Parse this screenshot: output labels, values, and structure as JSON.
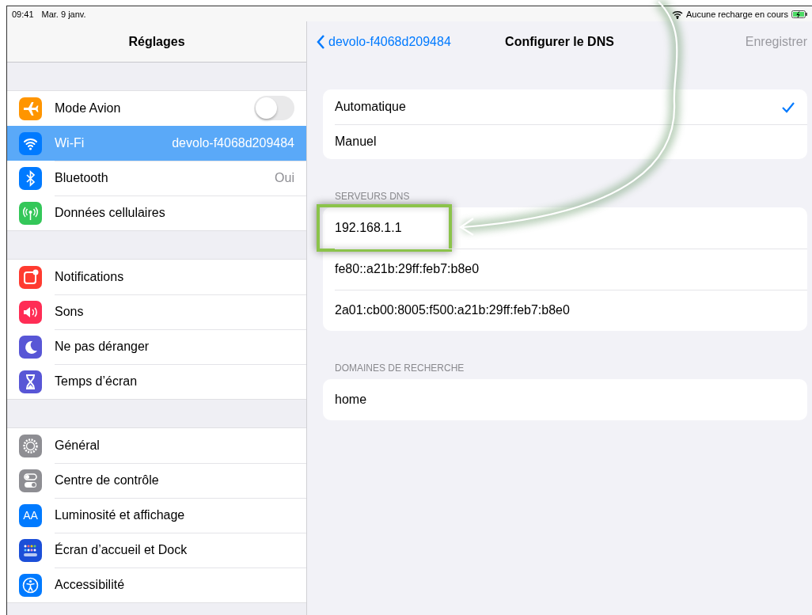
{
  "status_bar": {
    "time": "09:41",
    "date": "Mar. 9 janv.",
    "charging_text": "Aucune recharge en cours"
  },
  "sidebar": {
    "title": "Réglages",
    "sections": [
      [
        {
          "label": "Mode Avion",
          "kind": "toggle",
          "on": false,
          "selected": false,
          "color": "#ff9500"
        },
        {
          "label": "Wi-Fi",
          "value": "devolo-f4068d209484",
          "kind": "link",
          "selected": true,
          "color": "#007aff"
        },
        {
          "label": "Bluetooth",
          "value": "Oui",
          "kind": "link",
          "selected": false,
          "color": "#007aff"
        },
        {
          "label": "Données cellulaires",
          "kind": "link",
          "selected": false,
          "color": "#34c759"
        }
      ],
      [
        {
          "label": "Notifications",
          "kind": "link",
          "selected": false,
          "color": "#ff3b30"
        },
        {
          "label": "Sons",
          "kind": "link",
          "selected": false,
          "color": "#ff2d55"
        },
        {
          "label": "Ne pas déranger",
          "kind": "link",
          "selected": false,
          "color": "#5856d6"
        },
        {
          "label": "Temps d’écran",
          "kind": "link",
          "selected": false,
          "color": "#5856d6"
        }
      ],
      [
        {
          "label": "Général",
          "kind": "link",
          "selected": false,
          "color": "#8e8e93"
        },
        {
          "label": "Centre de contrôle",
          "kind": "link",
          "selected": false,
          "color": "#8e8e93"
        },
        {
          "label": "Luminosité et affichage",
          "kind": "link",
          "selected": false,
          "color": "#007aff",
          "icon_text": "AA"
        },
        {
          "label": "Écran d’accueil et Dock",
          "kind": "link",
          "selected": false,
          "color": "#1c4fd8"
        },
        {
          "label": "Accessibilité",
          "kind": "link",
          "selected": false,
          "color": "#007aff"
        }
      ]
    ]
  },
  "detail": {
    "back": "devolo-f4068d209484",
    "title": "Configurer le DNS",
    "save": {
      "label": "Enregistrer",
      "disabled": true
    },
    "modes": [
      {
        "label": "Automatique",
        "selected": true
      },
      {
        "label": "Manuel",
        "selected": false
      }
    ],
    "dns_header": "SERVEURS DNS",
    "dns_servers": [
      {
        "address": "192.168.1.1",
        "highlighted": true
      },
      {
        "address": "fe80::a21b:29ff:feb7:b8e0",
        "highlighted": false
      },
      {
        "address": "2a01:cb00:8005:f500:a21b:29ff:feb7:b8e0",
        "highlighted": false
      }
    ],
    "search_header": "DOMAINES DE RECHERCHE",
    "search_domains": [
      "home"
    ]
  }
}
